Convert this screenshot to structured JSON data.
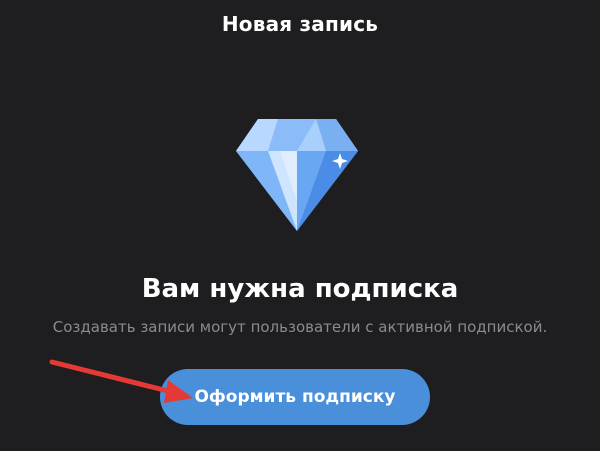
{
  "header": {
    "title": "Новая запись"
  },
  "main": {
    "icon": "diamond-icon",
    "headline": "Вам нужна подписка",
    "subtitle": "Создавать записи могут пользователи с активной подпиской.",
    "button_label": "Оформить подписку"
  },
  "annotation": {
    "icon": "red-arrow-icon"
  },
  "colors": {
    "background": "#1e1e20",
    "button": "#4a8fd9",
    "subtitle": "#8b8b8e",
    "arrow": "#e53935"
  }
}
